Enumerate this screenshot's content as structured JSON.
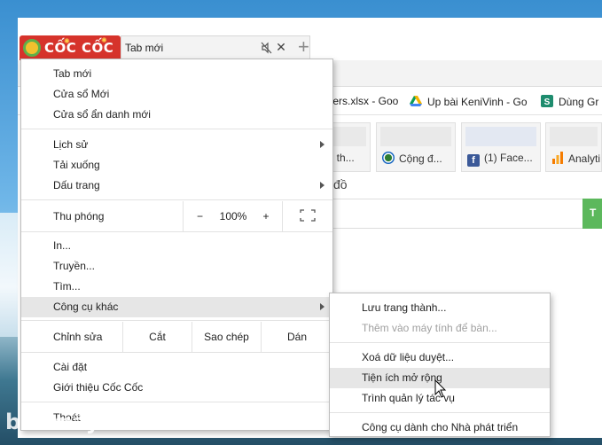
{
  "tab": {
    "title": "Tab mới"
  },
  "logo": {
    "brand": "CỐC CỐC"
  },
  "new_tab_symbol": "+",
  "bookmarks": [
    {
      "label": "ters.xlsx - Goo",
      "icon": "spreadsheet-icon"
    },
    {
      "label": "Up bài KeniVinh - Go",
      "icon": "google-drive-icon"
    },
    {
      "label": "Dùng Gr",
      "icon": "s-app-icon"
    }
  ],
  "tiles": [
    {
      "caption": "ng th..."
    },
    {
      "caption": "Cộng đ...",
      "icon": "community-icon"
    },
    {
      "caption": "(1) Face...",
      "icon": "facebook-icon"
    },
    {
      "caption": "Analyti",
      "icon": "analytics-icon"
    }
  ],
  "page_subtext": "đồ",
  "search_button": "T",
  "menu": {
    "new_tab": "Tab mới",
    "new_window": "Cửa sổ Mới",
    "incognito": "Cửa sổ ẩn danh mới",
    "history": "Lịch sử",
    "downloads": "Tải xuống",
    "bookmarks": "Dấu trang",
    "zoom_label": "Thu phóng",
    "zoom_minus": "−",
    "zoom_value": "100%",
    "zoom_plus": "+",
    "print": "In...",
    "cast": "Truyền...",
    "find": "Tìm...",
    "more_tools": "Công cụ khác",
    "edit_label": "Chỉnh sửa",
    "cut": "Cắt",
    "copy": "Sao chép",
    "paste": "Dán",
    "settings": "Cài đặt",
    "about": "Giới thiệu Cốc Cốc",
    "exit": "Thoát"
  },
  "submenu": {
    "save_page": "Lưu trang thành...",
    "add_to_desktop": "Thêm vào máy tính để bàn...",
    "clear_data": "Xoá dữ liệu duyệt...",
    "extensions": "Tiện ích mở rộng",
    "task_manager": "Trình quản lý tác vụ",
    "dev_tools": "Công cụ dành cho Nhà phát triển"
  },
  "watermark": "biếtmáytính",
  "colors": {
    "accent_green": "#5cb85c",
    "logo_red": "#d6332b",
    "highlight": "#e6e6e6"
  }
}
